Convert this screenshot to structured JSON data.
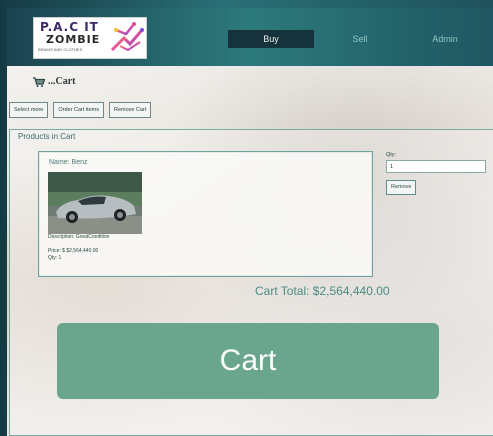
{
  "colors": {
    "header_dark": "#1b4350",
    "header_teal": "#2c7a7c",
    "accent_green": "#6aa68e",
    "total_text": "#4a8a84"
  },
  "logo": {
    "line1": "P.A.C IT",
    "line2": "ZOMBIE",
    "line3": "BRAINS AND CLOTHES"
  },
  "nav": {
    "buy": "Buy",
    "sell": "Sell",
    "admin": "Admin"
  },
  "page": {
    "title": "...Cart",
    "icon": "shopping-cart-icon"
  },
  "toolbar": {
    "select_more": "Select more",
    "order_cart_items": "Order Cart items",
    "remove_cart": "Remove Cart"
  },
  "products_panel": {
    "title": "Products in Cart"
  },
  "product": {
    "name": "Name: Benz",
    "description": "Description: GreatCondition",
    "price": "Price: $ $2,564,440.00",
    "qty": "Qty: 1",
    "image_icon": "car-photo"
  },
  "qty_editor": {
    "label": "Qty:",
    "value": "1",
    "remove_label": "Remove"
  },
  "cart_total": "Cart Total: $2,564,440.00",
  "big_button": "Cart"
}
